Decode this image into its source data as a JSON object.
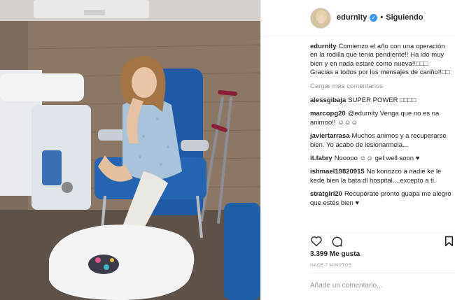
{
  "post": {
    "image_alt": "",
    "username": "edurnity",
    "verified_icon": "verified-badge-icon",
    "follow_status": "Siguiendo",
    "accent": "#3897f0"
  },
  "caption": {
    "username": "edurnity",
    "text": "Comienzo el año con una operación en la rodilla que tenía pendiente!! Ha ido muy bien y en nada estaré como nueva!!□□□ Gracias a todos por los mensajes de cariño!!□□"
  },
  "load_more": "Cargar más comentarios",
  "comments": [
    {
      "user": "alessgibaja",
      "text": "SUPER POWER □□□□"
    },
    {
      "user": "marcopg20",
      "text": "@edurnity Venga que no es na animoo!! ☺☺☺"
    },
    {
      "user": "javiertarrasa",
      "text": "Muchos animos y a recuperarse bien. Yo acabo de lesionarmela..."
    },
    {
      "user": "it.fabry",
      "text": "Nooooo ☺☺ get well soon ♥"
    },
    {
      "user": "ishmael19820915",
      "text": "No konozco a nadie ke le kede bien la bata dl hospital....excepto a ti."
    },
    {
      "user": "stratgirl20",
      "text": "Recupérate pronto guapa me alegro que estés bien ♥"
    }
  ],
  "actions": {
    "like_icon": "heart-outline-icon",
    "comment_icon": "comment-bubble-icon",
    "save_icon": "bookmark-icon"
  },
  "likes": "3.399 Me gusta",
  "timestamp": "HACE 7 MINUTOS",
  "add_comment_placeholder": "Añade un comentario..."
}
